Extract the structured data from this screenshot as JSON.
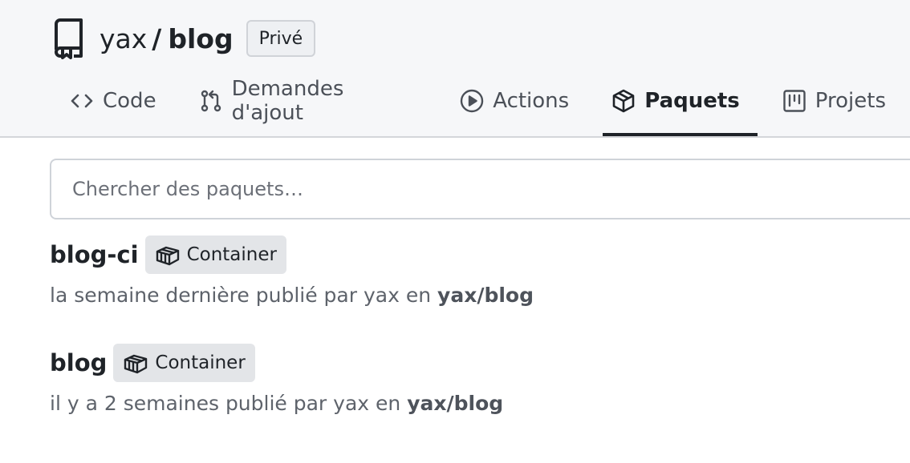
{
  "repo": {
    "owner": "yax",
    "separator": "/",
    "name": "blog",
    "visibility": "Privé"
  },
  "tabs": [
    {
      "label": "Code",
      "icon": "code-icon"
    },
    {
      "label": "Demandes d'ajout",
      "icon": "pull-request-icon"
    },
    {
      "label": "Actions",
      "icon": "play-circle-icon"
    },
    {
      "label": "Paquets",
      "icon": "package-icon",
      "active": true
    },
    {
      "label": "Projets",
      "icon": "project-board-icon"
    }
  ],
  "search": {
    "placeholder": "Chercher des paquets…"
  },
  "packages": [
    {
      "name": "blog-ci",
      "type": "Container",
      "time": "la semaine dernière",
      "published_by": "publié par",
      "author": "yax",
      "in": "en",
      "repo": "yax/blog"
    },
    {
      "name": "blog",
      "type": "Container",
      "time": "il y a 2 semaines",
      "published_by": "publié par",
      "author": "yax",
      "in": "en",
      "repo": "yax/blog"
    }
  ]
}
